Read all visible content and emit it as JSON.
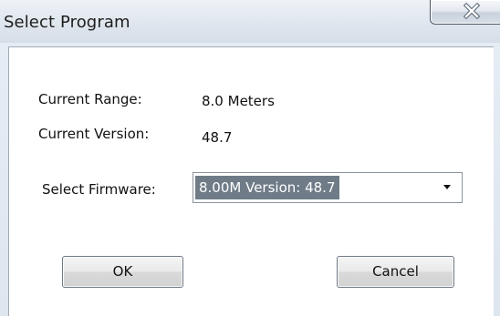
{
  "window": {
    "title": "Select Program"
  },
  "info": {
    "range_label": "Current Range:",
    "range_value": "8.0 Meters",
    "version_label": "Current Version:",
    "version_value": "48.7"
  },
  "firmware": {
    "label": "Select Firmware:",
    "selected": "8.00M  Version: 48.7"
  },
  "buttons": {
    "ok": "OK",
    "cancel": "Cancel"
  },
  "icons": {
    "close": "close-icon",
    "dropdown": "chevron-down-icon"
  }
}
